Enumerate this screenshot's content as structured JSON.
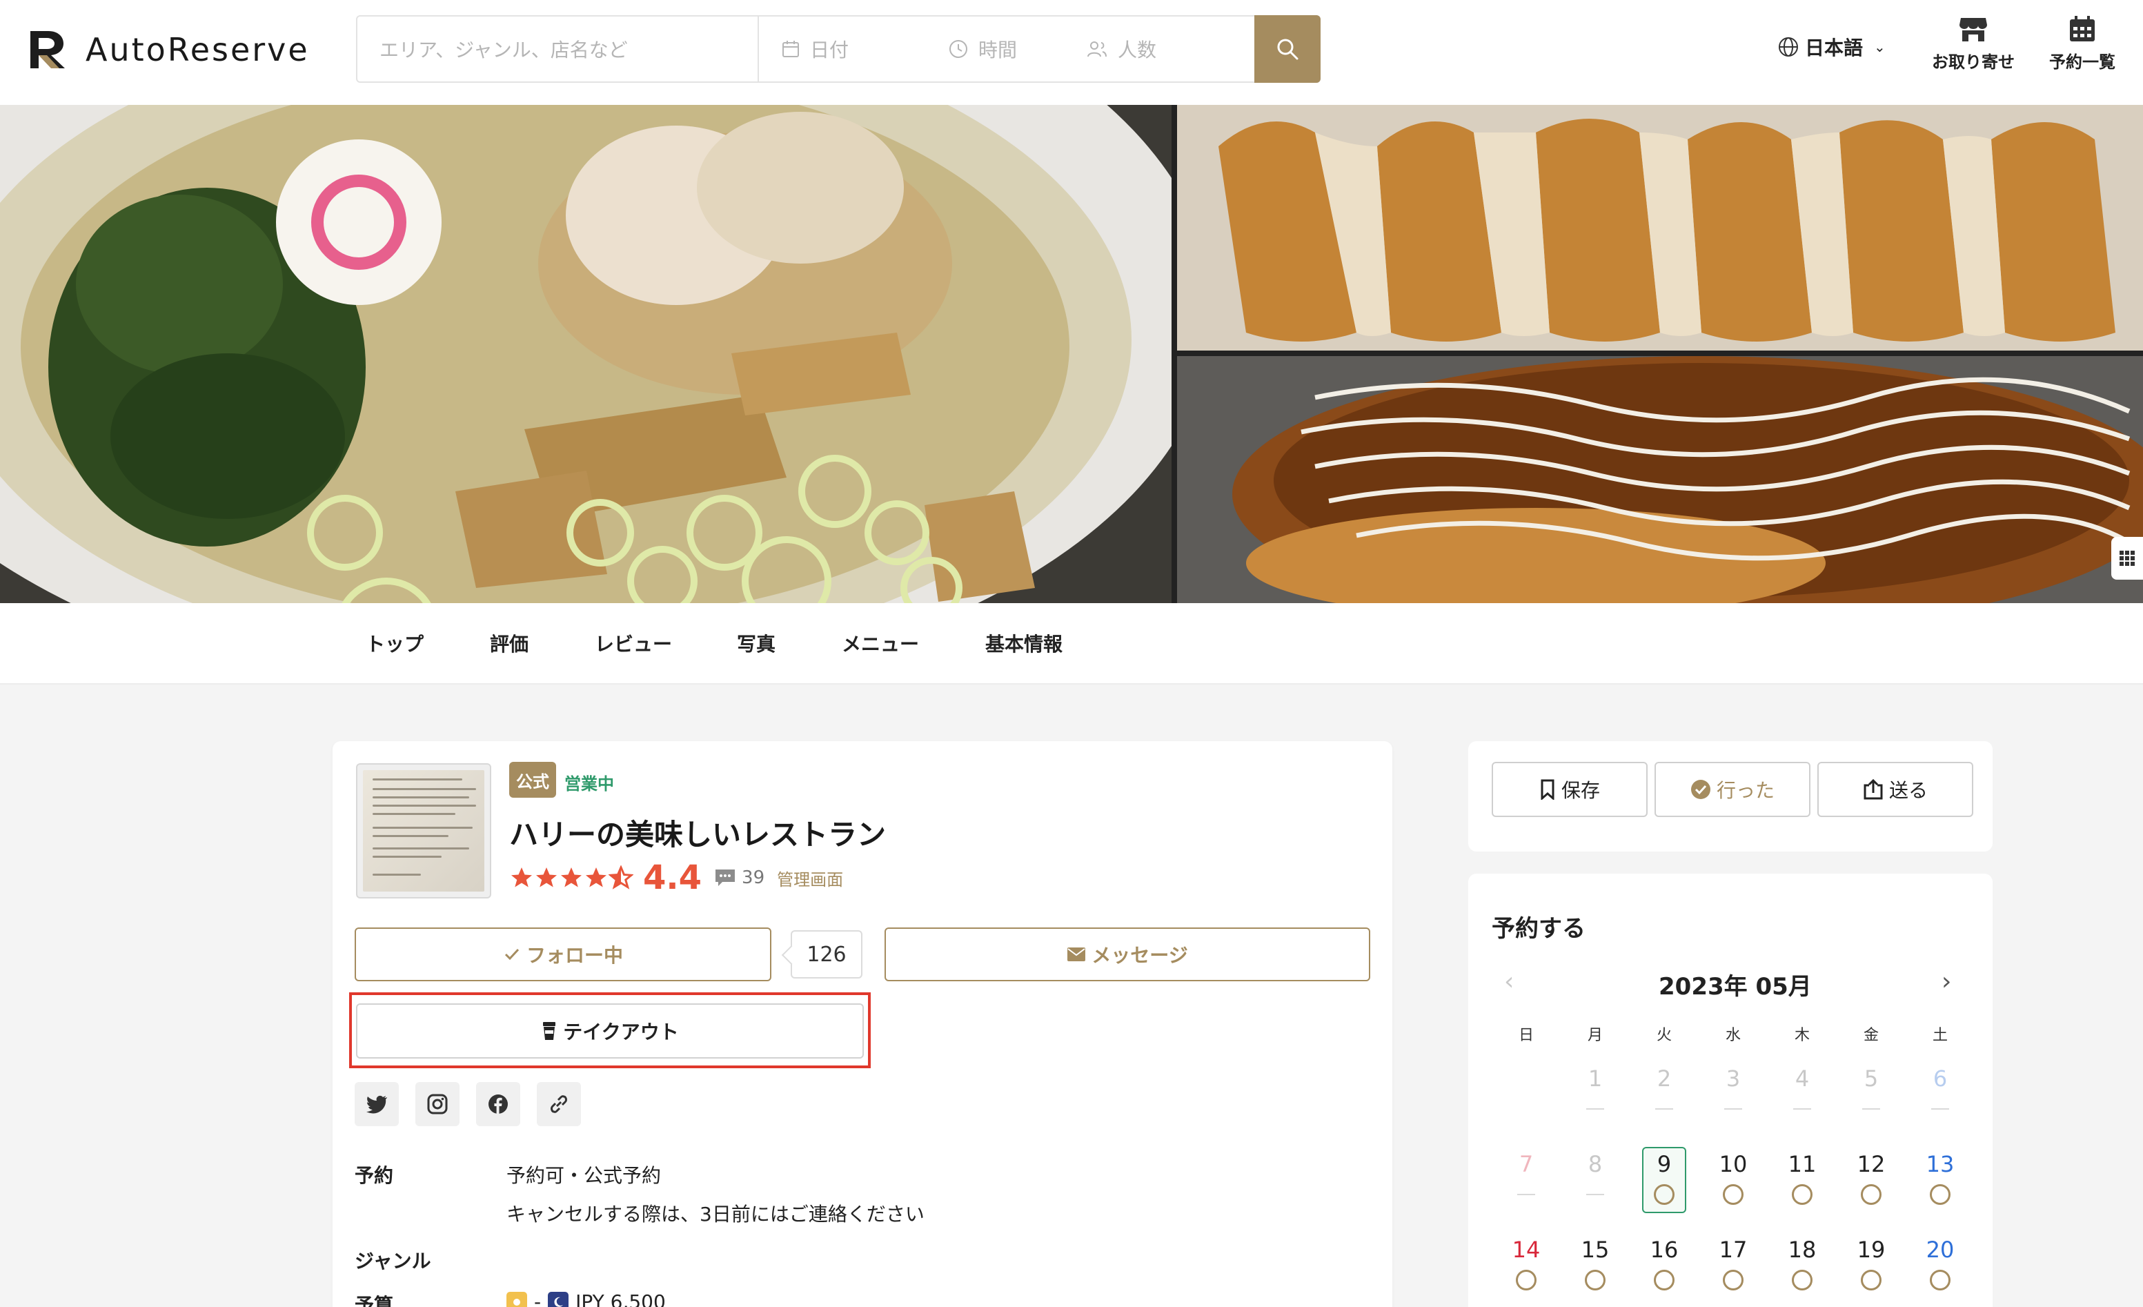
{
  "header": {
    "logo_text": "AutoReserve",
    "search_placeholder": "エリア、ジャンル、店名など",
    "date_label": "日付",
    "time_label": "時間",
    "people_label": "人数",
    "language": "日本語",
    "takeout_label": "お取り寄せ",
    "reservations_label": "予約一覧"
  },
  "tabs": [
    "トップ",
    "評価",
    "レビュー",
    "写真",
    "メニュー",
    "基本情報"
  ],
  "restaurant": {
    "official_badge": "公式",
    "status": "営業中",
    "name": "ハリーの美味しいレストラン",
    "rating": "4.4",
    "rating_value": 4.4,
    "review_count": "39",
    "admin_link": "管理画面",
    "follow_label": "フォロー中",
    "follow_count": "126",
    "message_label": "メッセージ",
    "takeout_label": "テイクアウト"
  },
  "info": {
    "reservation_label": "予約",
    "reservation_value": "予約可・公式予約",
    "reservation_note": "キャンセルする際は、3日前にはご連絡ください",
    "genre_label": "ジャンル",
    "budget_label": "予算",
    "budget_value": "JPY 6,500"
  },
  "actions": {
    "save": "保存",
    "went": "行った",
    "send": "送る"
  },
  "reserve": {
    "title": "予約する",
    "month": "2023年 05月",
    "weekdays": [
      "日",
      "月",
      "火",
      "水",
      "木",
      "金",
      "土"
    ],
    "week1": [
      "1",
      "2",
      "3",
      "4",
      "5",
      "6"
    ],
    "week2": [
      "7",
      "8",
      "9",
      "10",
      "11",
      "12",
      "13"
    ],
    "week3": [
      "14",
      "15",
      "16",
      "17",
      "18",
      "19",
      "20"
    ],
    "selected_day": "9"
  },
  "colors": {
    "brand": "#a58c5f",
    "rating": "#e8553a",
    "open": "#2f9a6b",
    "highlight": "#e0382c"
  }
}
